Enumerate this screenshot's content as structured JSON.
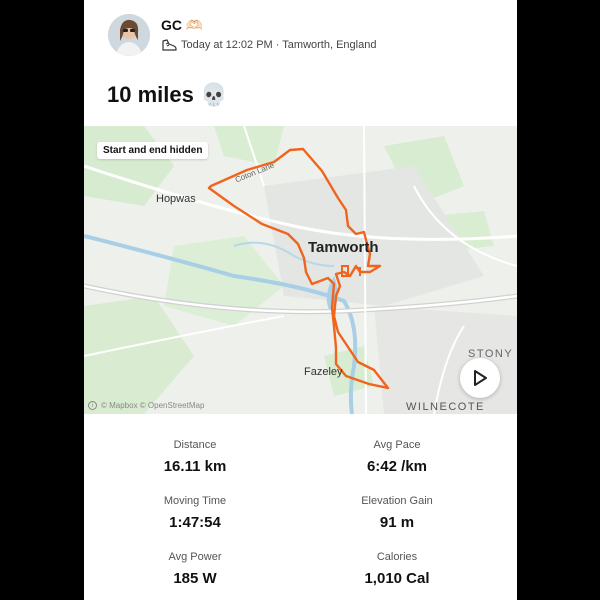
{
  "athlete": {
    "name": "GC 🫶🏻",
    "meta": "Today at 12:02 PM · Tamworth, England"
  },
  "activity": {
    "title": "10 miles 💀"
  },
  "map": {
    "badge": "Start and end hidden",
    "labels": {
      "hopwas": "Hopwas",
      "tamworth": "Tamworth",
      "fazeley": "Fazeley",
      "stony": "STONY",
      "wilnecote": "WILNECOTE",
      "canal": "Coton Lane"
    },
    "attribution": "© Mapbox © OpenStreetMap",
    "route_color": "#f0641e"
  },
  "stats": [
    {
      "label": "Distance",
      "value": "16.11 km"
    },
    {
      "label": "Avg Pace",
      "value": "6:42 /km"
    },
    {
      "label": "Moving Time",
      "value": "1:47:54"
    },
    {
      "label": "Elevation Gain",
      "value": "91 m"
    },
    {
      "label": "Avg Power",
      "value": "185 W"
    },
    {
      "label": "Calories",
      "value": "1,010 Cal"
    }
  ]
}
